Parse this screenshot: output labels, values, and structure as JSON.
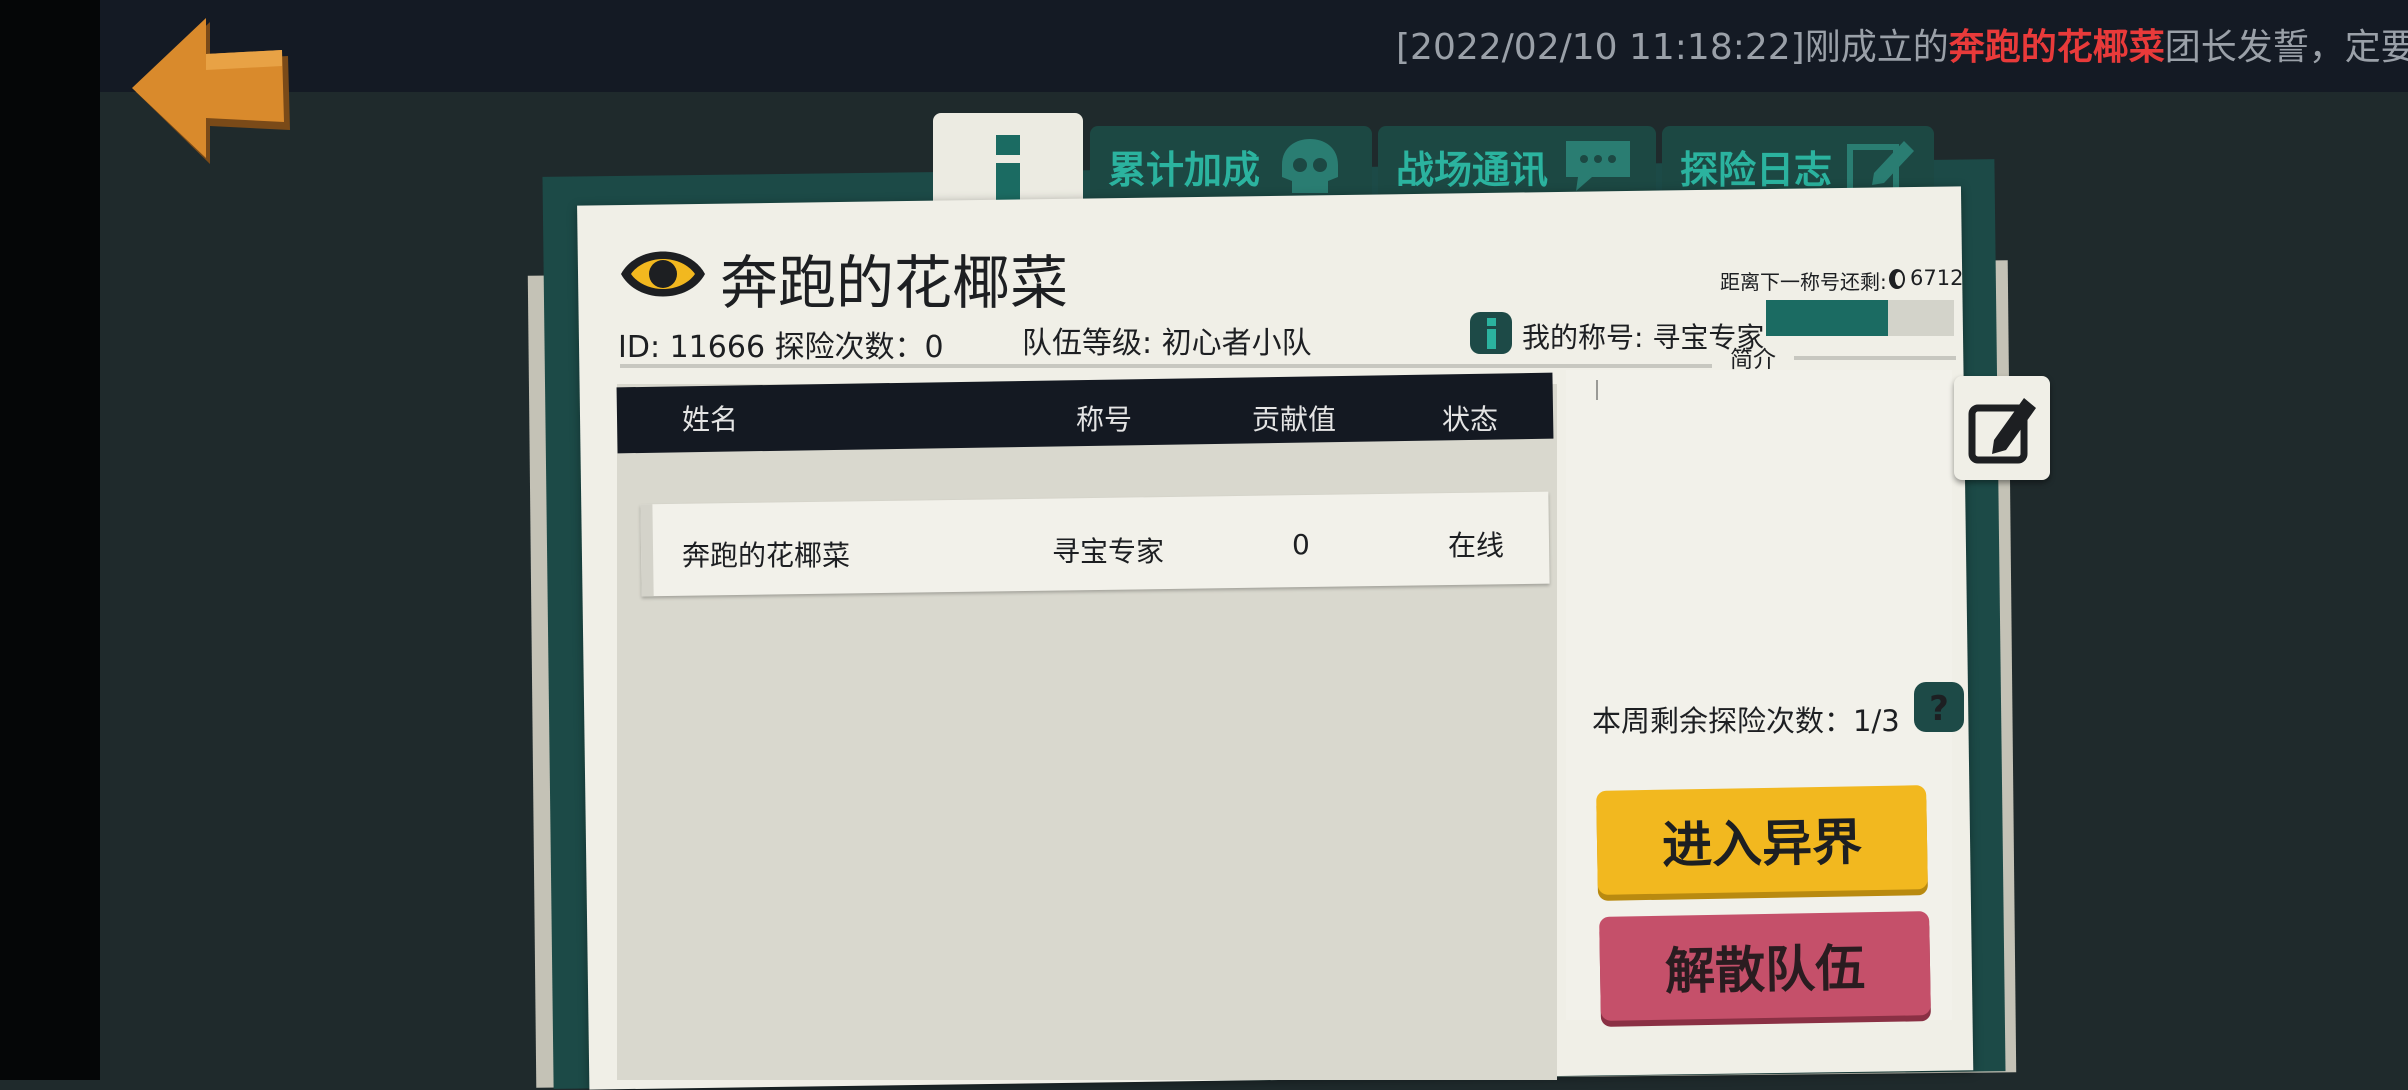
{
  "ticker": {
    "prefix": "[2022/02/10 11:18:22]刚成立的",
    "name": "奔跑的花椰菜",
    "suffix": "团长发誓，定要带领大"
  },
  "tabs": {
    "cumulative": "累计加成",
    "battlefield": "战场通讯",
    "journal": "探险日志"
  },
  "team": {
    "name": "奔跑的花椰菜",
    "id_line": "ID: 11666 探险次数：0",
    "level_line": "队伍等级: 初心者小队",
    "next_title_label": "距离下一称号还剩:",
    "next_title_value": "6712",
    "my_title": "我的称号: 寻宝专家",
    "title_progress": 0.65,
    "intro_label": "简介"
  },
  "table": {
    "headers": [
      "姓名",
      "称号",
      "贡献值",
      "状态"
    ],
    "rows": [
      {
        "name": "奔跑的花椰菜",
        "title": "寻宝专家",
        "contribution": "0",
        "status": "在线"
      }
    ]
  },
  "weekly_remaining": "本周剩余探险次数：1/3",
  "buttons": {
    "enter": "进入异界",
    "disband": "解散队伍"
  },
  "colors": {
    "accent_teal": "#1b6b62",
    "button_yellow": "#f2b81f",
    "button_red": "#c5506a",
    "ticker_highlight": "#e83a3a"
  }
}
